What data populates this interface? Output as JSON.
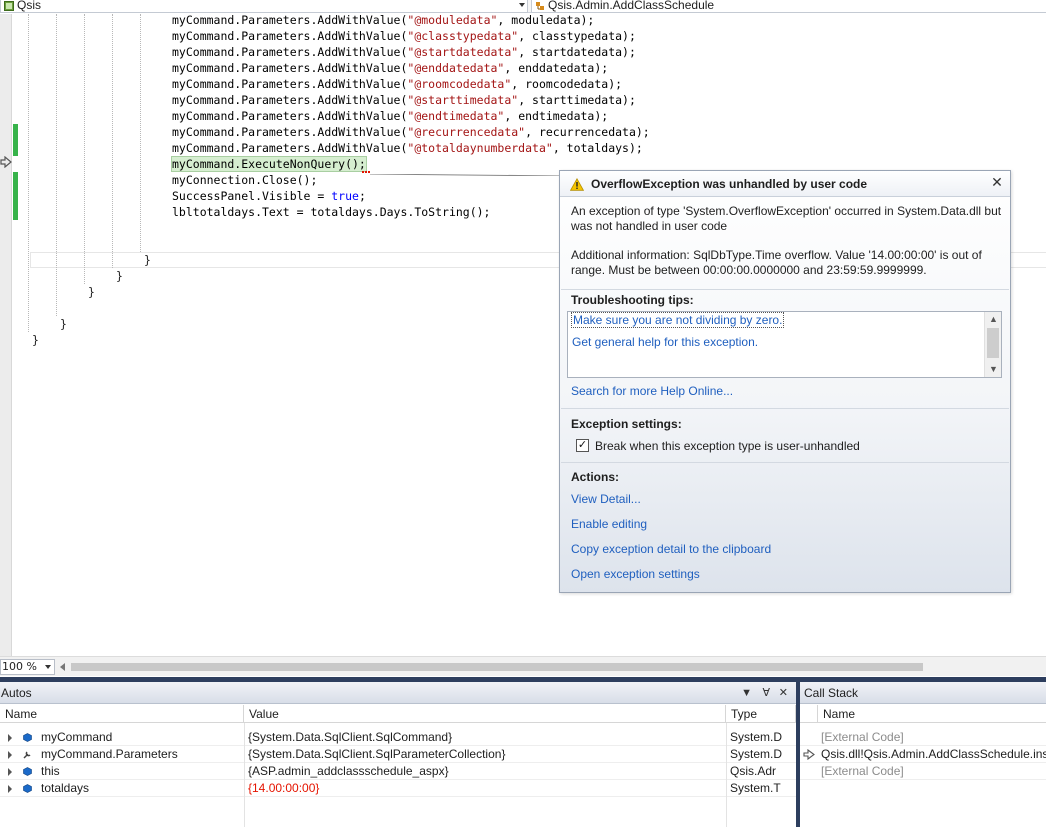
{
  "navigation": {
    "left_combo": "Qsis",
    "right_combo": "Qsis.Admin.AddClassSchedule"
  },
  "code": {
    "lines": [
      {
        "prefix": "myCommand.Parameters.AddWithValue(",
        "string": "\"@moduledata\"",
        "suffix": ", moduledata);"
      },
      {
        "prefix": "myCommand.Parameters.AddWithValue(",
        "string": "\"@classtypedata\"",
        "suffix": ", classtypedata);"
      },
      {
        "prefix": "myCommand.Parameters.AddWithValue(",
        "string": "\"@startdatedata\"",
        "suffix": ", startdatedata);"
      },
      {
        "prefix": "myCommand.Parameters.AddWithValue(",
        "string": "\"@enddatedata\"",
        "suffix": ", enddatedata);"
      },
      {
        "prefix": "myCommand.Parameters.AddWithValue(",
        "string": "\"@roomcodedata\"",
        "suffix": ", roomcodedata);"
      },
      {
        "prefix": "myCommand.Parameters.AddWithValue(",
        "string": "\"@starttimedata\"",
        "suffix": ", starttimedata);"
      },
      {
        "prefix": "myCommand.Parameters.AddWithValue(",
        "string": "\"@endtimedata\"",
        "suffix": ", endtimedata);"
      },
      {
        "prefix": "myCommand.Parameters.AddWithValue(",
        "string": "\"@recurrencedata\"",
        "suffix": ", recurrencedata);"
      },
      {
        "prefix": "myCommand.Parameters.AddWithValue(",
        "string": "\"@totaldaynumberdata\"",
        "suffix": ", totaldays);"
      }
    ],
    "current_statement": "myCommand.ExecuteNonQuery();",
    "line_close": "myConnection.Close();",
    "line_visible_prefix": "SuccessPanel.Visible = ",
    "line_visible_keyword": "true",
    "line_visible_suffix": ";",
    "line_label": "lbltotaldays.Text = totaldays.Days.ToString();",
    "brace": "}"
  },
  "exception": {
    "title": "OverflowException was unhandled by user code",
    "close_glyph": "✕",
    "description": "An exception of type 'System.OverflowException' occurred in System.Data.dll but was not handled in user code",
    "additional_info": "Additional information: SqlDbType.Time overflow.  Value '14.00:00:00' is out of range.  Must be between 00:00:00.0000000 and 23:59:59.9999999.",
    "tips_heading": "Troubleshooting tips:",
    "tips": [
      "Make sure you are not dividing by zero.",
      "Get general help for this exception."
    ],
    "search_link": "Search for more Help Online...",
    "settings_heading": "Exception settings:",
    "checkbox_label": "Break when this exception type is user-unhandled",
    "checkbox_checked": true,
    "actions_heading": "Actions:",
    "actions": [
      "View Detail...",
      "Enable editing",
      "Copy exception detail to the clipboard",
      "Open exception settings"
    ]
  },
  "zoom": "100 %",
  "autos": {
    "title": "Autos",
    "columns": [
      "Name",
      "Value",
      "Type"
    ],
    "rows": [
      {
        "name": "myCommand",
        "value": "{System.Data.SqlClient.SqlCommand}",
        "type": "System.D",
        "icon": "object-icon",
        "changed": false
      },
      {
        "name": "myCommand.Parameters",
        "value": "{System.Data.SqlClient.SqlParameterCollection}",
        "type": "System.D",
        "icon": "property-wrench-icon",
        "changed": false
      },
      {
        "name": "this",
        "value": "{ASP.admin_addclassschedule_aspx}",
        "type": "Qsis.Adr",
        "icon": "object-icon",
        "changed": false
      },
      {
        "name": "totaldays",
        "value": "{14.00:00:00}",
        "type": "System.T",
        "icon": "object-icon",
        "changed": true
      }
    ]
  },
  "callstack": {
    "title": "Call Stack",
    "columns": [
      "Name"
    ],
    "rows": [
      {
        "name": "[External Code]",
        "current": false
      },
      {
        "name": "Qsis.dll!Qsis.Admin.AddClassSchedule.inse",
        "current": true
      },
      {
        "name": "[External Code]",
        "current": false
      }
    ]
  },
  "colors": {
    "accent_link": "#1f5fbf",
    "changed_value": "#e51400",
    "change_bar": "#37b34a",
    "tool_frame": "#2d3e5e"
  }
}
